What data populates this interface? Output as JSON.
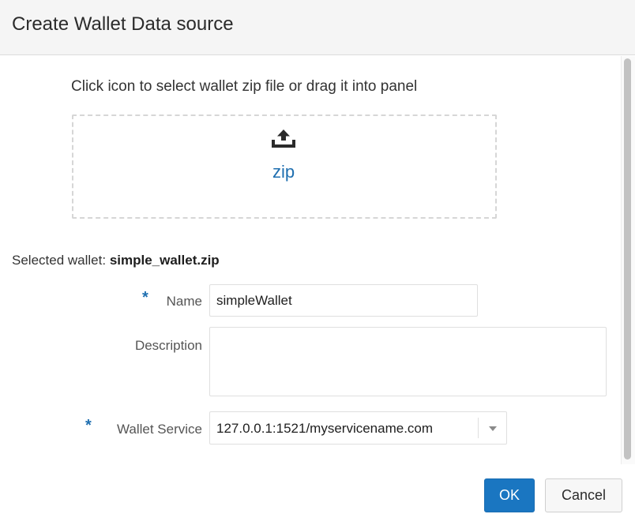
{
  "dialog": {
    "title": "Create Wallet Data source"
  },
  "upload": {
    "instruction": "Click icon to select wallet zip file or drag it into panel",
    "file_type_label": "zip",
    "icon": "upload-icon"
  },
  "selected_wallet": {
    "label": "Selected wallet:",
    "filename": "simple_wallet.zip"
  },
  "form": {
    "required_marker": "*",
    "name": {
      "label": "Name",
      "value": "simpleWallet",
      "required": true
    },
    "description": {
      "label": "Description",
      "value": "",
      "required": false
    },
    "wallet_service": {
      "label": "Wallet Service",
      "selected": "127.0.0.1:1521/myservicename.com",
      "required": true,
      "icon": "chevron-down-icon"
    }
  },
  "buttons": {
    "ok": "OK",
    "cancel": "Cancel"
  },
  "colors": {
    "accent": "#1a76c1",
    "link": "#1f6fb0",
    "header_bg": "#f5f5f5"
  }
}
